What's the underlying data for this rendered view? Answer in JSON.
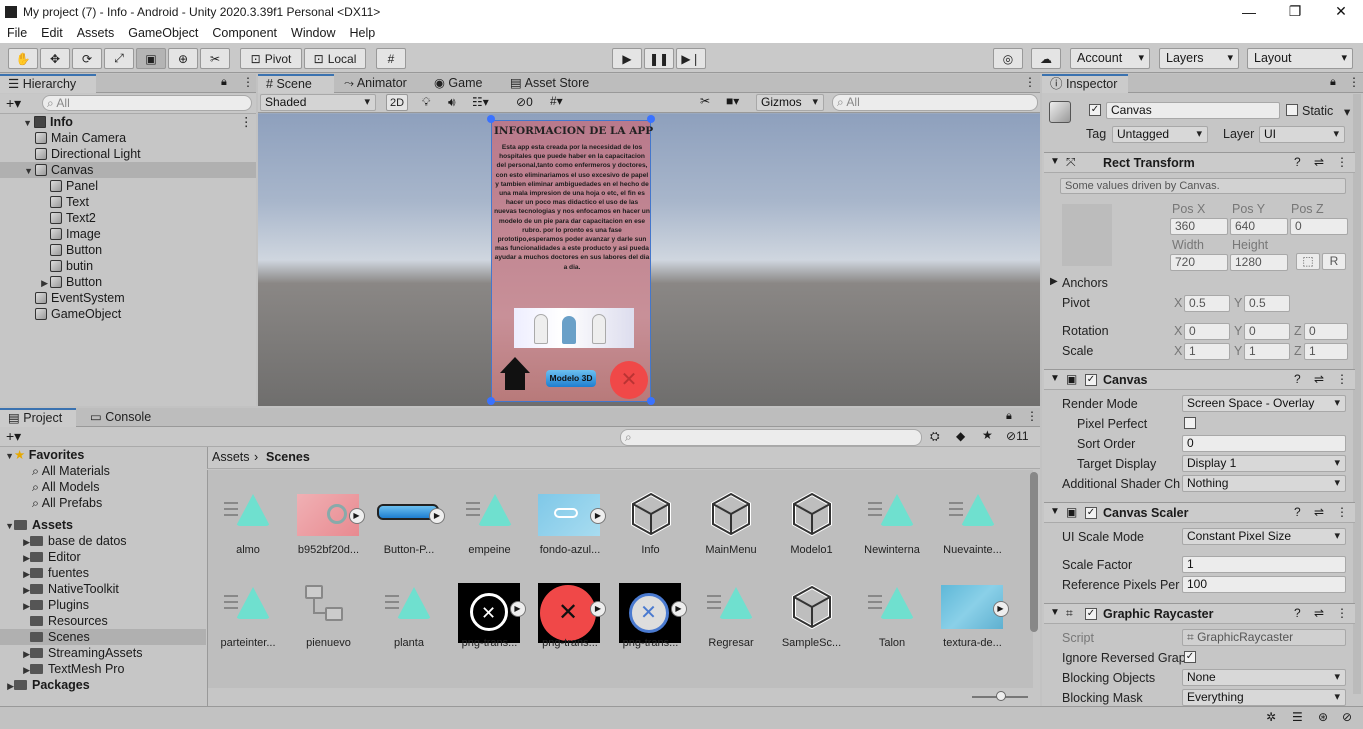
{
  "window": {
    "title": "My project (7) - Info - Android - Unity 2020.3.39f1 Personal <DX11>"
  },
  "menu": [
    "File",
    "Edit",
    "Assets",
    "GameObject",
    "Component",
    "Window",
    "Help"
  ],
  "toolbar": {
    "pivot": "Pivot",
    "local": "Local",
    "account": "Account",
    "layers": "Layers",
    "layout": "Layout"
  },
  "hierarchy": {
    "tab": "Hierarchy",
    "search": "All",
    "items": [
      {
        "label": "Info",
        "depth": 0,
        "sel": false,
        "arrow": "▼",
        "scene": true
      },
      {
        "label": "Main Camera",
        "depth": 1
      },
      {
        "label": "Directional Light",
        "depth": 1
      },
      {
        "label": "Canvas",
        "depth": 1,
        "arrow": "▼",
        "sel": true
      },
      {
        "label": "Panel",
        "depth": 2
      },
      {
        "label": "Text",
        "depth": 2
      },
      {
        "label": "Text2",
        "depth": 2
      },
      {
        "label": "Image",
        "depth": 2
      },
      {
        "label": "Button",
        "depth": 2
      },
      {
        "label": "butin",
        "depth": 2
      },
      {
        "label": "Button",
        "depth": 2,
        "arrow": "▶"
      },
      {
        "label": "EventSystem",
        "depth": 1
      },
      {
        "label": "GameObject",
        "depth": 1
      }
    ]
  },
  "scene_tabs": [
    "Scene",
    "Animator",
    "Game",
    "Asset Store"
  ],
  "scene_toolbar": {
    "shading": "Shaded",
    "mode2d": "2D",
    "hidden_count": "0",
    "gizmos": "Gizmos",
    "search": "All"
  },
  "canvas_preview": {
    "heading": "INFORMACION DE LA APP",
    "body": "Esta app esta creada por la necesidad de los hospitales que puede haber en la capacitacion del personal,tanto como enfermeros y doctores, con esto eliminariamos el uso excesivo de papel y tambien eliminar ambiguedades en el hecho de una mala impresion de una hoja o etc, el fin es hacer un poco mas didactico el uso de las nuevas tecnologias y nos enfocamos en hacer un modelo de un pie para dar capacitacion en ese rubro. por lo pronto es una fase prototipo,esperamos poder avanzar y darle sun mas funcionalidades a este producto y asi pueda ayudar a muchos doctores en sus labores del dia a dia.",
    "button": "Modelo 3D"
  },
  "project": {
    "tabs": [
      "Project",
      "Console"
    ],
    "hidden_count": "11",
    "breadcrumb": [
      "Assets",
      "Scenes"
    ],
    "favorites": {
      "label": "Favorites",
      "items": [
        "All Materials",
        "All Models",
        "All Prefabs"
      ]
    },
    "assets": {
      "label": "Assets",
      "items": [
        "base de datos",
        "Editor",
        "fuentes",
        "NativeToolkit",
        "Plugins",
        "Resources",
        "Scenes",
        "StreamingAssets",
        "TextMesh Pro"
      ]
    },
    "packages": "Packages",
    "grid": [
      {
        "label": "almo",
        "kind": "anim"
      },
      {
        "label": "b952bf20d...",
        "kind": "pink",
        "play": true
      },
      {
        "label": "Button-P...",
        "kind": "bluebtn",
        "play": true
      },
      {
        "label": "empeine",
        "kind": "anim"
      },
      {
        "label": "fondo-azul...",
        "kind": "bluebg",
        "play": true
      },
      {
        "label": "Info",
        "kind": "unity"
      },
      {
        "label": "MainMenu",
        "kind": "unity"
      },
      {
        "label": "Modelo1",
        "kind": "unity"
      },
      {
        "label": "Newinterna",
        "kind": "anim"
      },
      {
        "label": "Nuevainte...",
        "kind": "anim"
      },
      {
        "label": "parteinter...",
        "kind": "anim"
      },
      {
        "label": "pienuevo",
        "kind": "ctrl"
      },
      {
        "label": "planta",
        "kind": "anim"
      },
      {
        "label": "png-trans...",
        "kind": "blackcircle",
        "play": true
      },
      {
        "label": "png-trans...",
        "kind": "redx",
        "play": true
      },
      {
        "label": "png-trans...",
        "kind": "bluex",
        "play": true
      },
      {
        "label": "Regresar",
        "kind": "anim"
      },
      {
        "label": "SampleSc...",
        "kind": "unity"
      },
      {
        "label": "Talon",
        "kind": "anim"
      },
      {
        "label": "textura-de...",
        "kind": "texture",
        "play": true
      }
    ]
  },
  "inspector": {
    "tab": "Inspector",
    "name": "Canvas",
    "static": "Static",
    "tag_label": "Tag",
    "tag": "Untagged",
    "layer_label": "Layer",
    "layer": "UI",
    "rect": {
      "title": "Rect Transform",
      "note": "Some values driven by Canvas.",
      "posx_l": "Pos X",
      "posy_l": "Pos Y",
      "posz_l": "Pos Z",
      "posx": "360",
      "posy": "640",
      "posz": "0",
      "w_l": "Width",
      "h_l": "Height",
      "w": "720",
      "h": "1280",
      "anchors": "Anchors",
      "pivot": "Pivot",
      "pivot_x": "0.5",
      "pivot_y": "0.5",
      "rotation": "Rotation",
      "rot_x": "0",
      "rot_y": "0",
      "rot_z": "0",
      "scale": "Scale",
      "scale_x": "1",
      "scale_y": "1",
      "scale_z": "1",
      "r_btn": "R"
    },
    "canvas": {
      "title": "Canvas",
      "render_mode_l": "Render Mode",
      "render_mode": "Screen Space - Overlay",
      "pixel_perfect": "Pixel Perfect",
      "sort_order_l": "Sort Order",
      "sort_order": "0",
      "target_display_l": "Target Display",
      "target_display": "Display 1",
      "shader_l": "Additional Shader Ch",
      "shader": "Nothing"
    },
    "scaler": {
      "title": "Canvas Scaler",
      "mode_l": "UI Scale Mode",
      "mode": "Constant Pixel Size",
      "factor_l": "Scale Factor",
      "factor": "1",
      "ref_l": "Reference Pixels Per",
      "ref": "100"
    },
    "raycaster": {
      "title": "Graphic Raycaster",
      "script_l": "Script",
      "script": "GraphicRaycaster",
      "ignore_l": "Ignore Reversed Grap",
      "blocking_l": "Blocking Objects",
      "blocking": "None",
      "mask_l": "Blocking Mask",
      "mask": "Everything"
    }
  },
  "colors": {
    "accent": "#3a72b0",
    "anim": "#6fe0cf",
    "selected": "#b0b0b0"
  }
}
